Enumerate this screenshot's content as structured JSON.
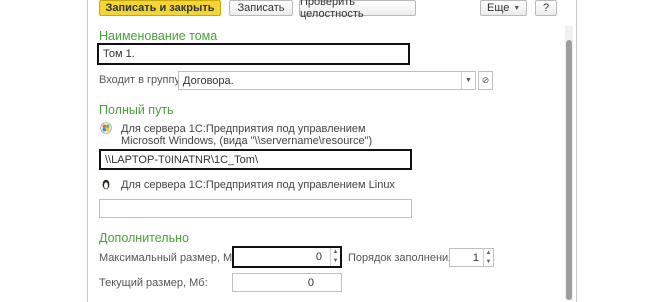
{
  "toolbar": {
    "save_close_label": "Записать и закрыть",
    "save_label": "Записать",
    "check_integrity_label": "Проверить целостность",
    "more_label": "Еще",
    "help_label": "?"
  },
  "volume_name": {
    "heading": "Наименование тома",
    "value": "Том 1."
  },
  "group": {
    "label": "Входит в группу:",
    "value": "Договора."
  },
  "full_path": {
    "heading": "Полный путь",
    "windows_text": "Для сервера 1С:Предприятия под управлением Microsoft Windows, (вида \"\\\\servername\\resource\")",
    "windows_value": "\\\\LAPTOP-T0INATNR\\1C_Tom\\",
    "linux_text": "Для сервера 1С:Предприятия под управлением Linux",
    "linux_value": ""
  },
  "additional": {
    "heading": "Дополнительно",
    "max_size_label": "Максимальный размер, Мб:",
    "max_size_value": "0",
    "fill_order_label": "Порядок заполнения:",
    "fill_order_value": "1",
    "current_size_label": "Текущий размер, Мб:",
    "current_size_value": "0"
  },
  "colors": {
    "accent": "#f3d535",
    "section_heading": "#4aa03a"
  },
  "icons": {
    "windows": "windows-icon",
    "linux": "linux-penguin-icon"
  }
}
